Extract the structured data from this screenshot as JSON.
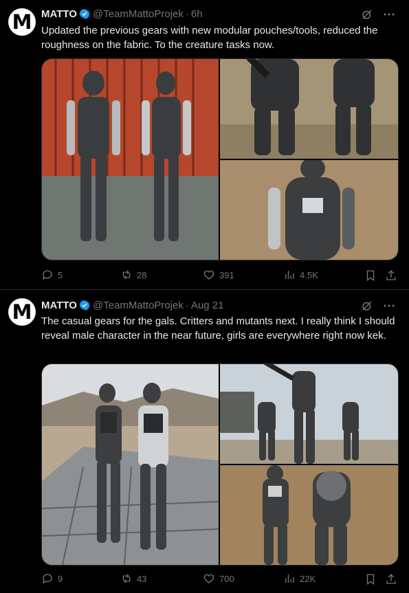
{
  "tweets": [
    {
      "author_name": "MATTO",
      "handle": "@TeamMattoProjek",
      "separator": "·",
      "time": "6h",
      "text": "Updated the previous gears with new modular pouches/tools, reduced the roughness on the fabric. To the creature tasks now.",
      "stats": {
        "replies": "5",
        "reposts": "28",
        "likes": "391",
        "views": "4.5K"
      }
    },
    {
      "author_name": "MATTO",
      "handle": "@TeamMattoProjek",
      "separator": "·",
      "time": "Aug 21",
      "text": "The casual gears for the gals. Critters and mutants next. I really think I should reveal male character in the near future, girls are everywhere right now kek.",
      "stats": {
        "replies": "9",
        "reposts": "43",
        "likes": "700",
        "views": "22K"
      }
    }
  ],
  "avatar_logo_text": "M",
  "colors": {
    "background": "#000000",
    "text": "#e7e9ea",
    "muted": "#71767b",
    "verified": "#1d9bf0",
    "divider": "#2f3336"
  }
}
